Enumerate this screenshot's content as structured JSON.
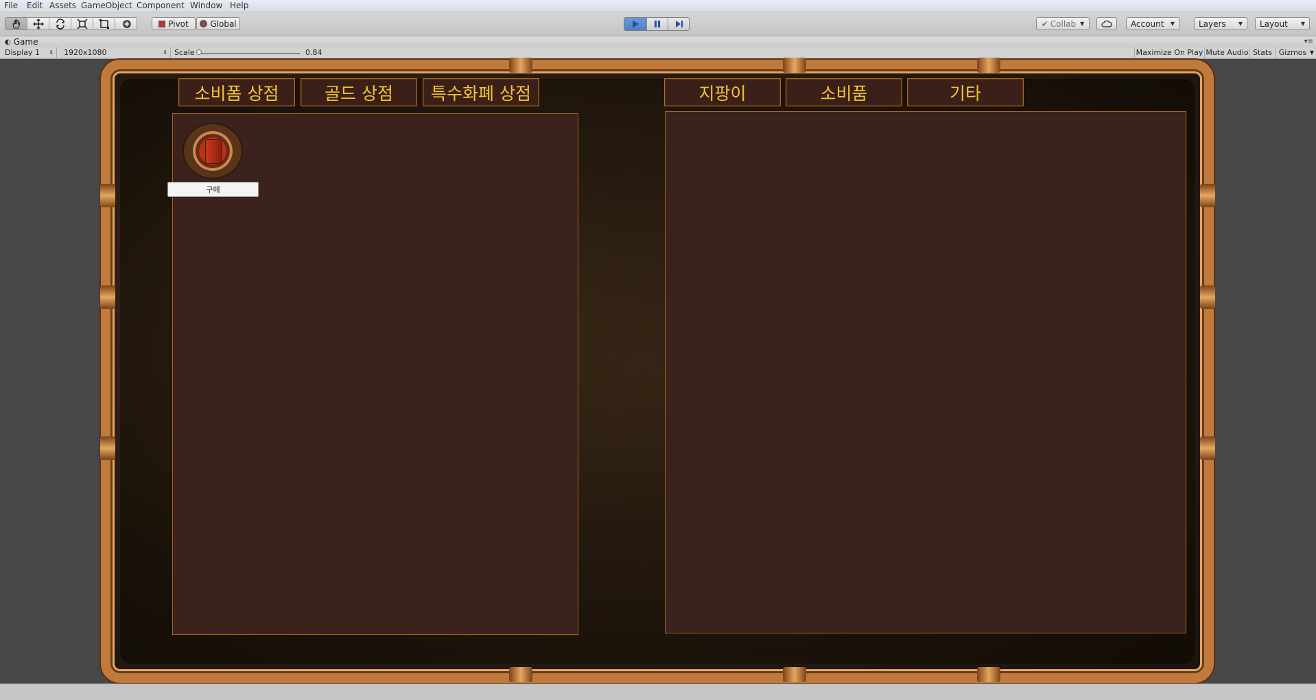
{
  "menu": [
    "File",
    "Edit",
    "Assets",
    "GameObject",
    "Component",
    "Window",
    "Help"
  ],
  "toolbar": {
    "pivot_label": "Pivot",
    "global_label": "Global",
    "collab_label": "Collab",
    "account_label": "Account",
    "layers_label": "Layers",
    "layout_label": "Layout",
    "tools": [
      "hand-tool-icon",
      "move-tool-icon",
      "rotate-tool-icon",
      "scale-tool-icon",
      "rect-tool-icon",
      "transform-tool-icon"
    ],
    "active_tool": "hand-tool-icon",
    "play_active": true
  },
  "game_tab": {
    "title": "Game"
  },
  "game_bar": {
    "display": "Display 1",
    "resolution": "1920x1080",
    "scale_label": "Scale",
    "scale_value": "0.84",
    "maximize_on_play": "Maximize On Play",
    "mute_audio": "Mute Audio",
    "stats": "Stats",
    "gizmos": "Gizmos"
  },
  "shop": {
    "left_tabs": [
      "소비폼 상점",
      "골드 상점",
      "특수화폐 상점"
    ],
    "right_tabs": [
      "지팡이",
      "소비품",
      "기타"
    ],
    "buy_label": "구매"
  },
  "colors": {
    "frame_copper": "#c07a3c",
    "tab_text_gold": "#f0c336",
    "panel_bg": "#3b221c",
    "play_accent": "#4f7fc4"
  }
}
